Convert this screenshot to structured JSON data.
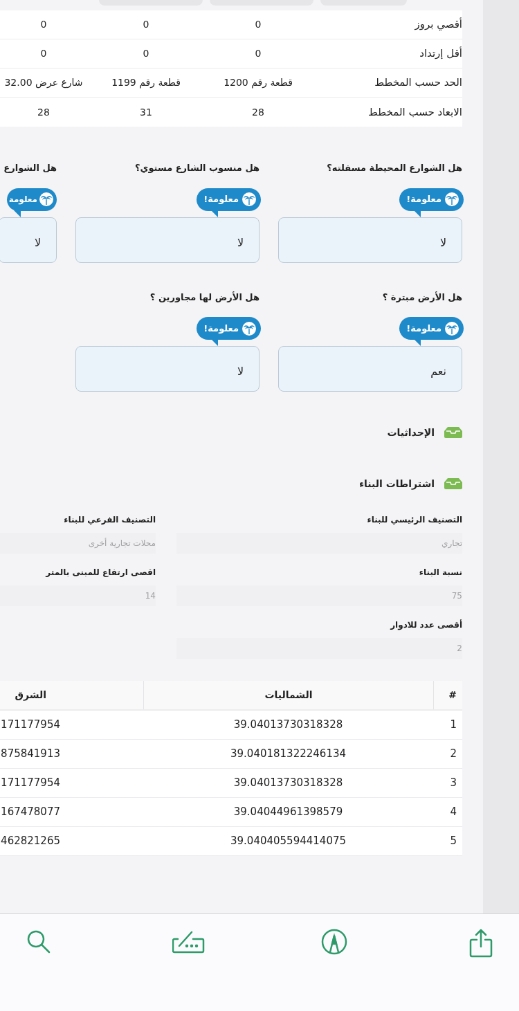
{
  "limits_table": {
    "rows": [
      {
        "label": "أقصي بروز",
        "values": [
          "0",
          "0",
          "0"
        ]
      },
      {
        "label": "أقل إرتداد",
        "values": [
          "0",
          "0",
          "0"
        ]
      },
      {
        "label": "الحد حسب المخطط",
        "values": [
          "قطعة رقم 1200",
          "قطعة رقم 1199",
          "شارع عرض 32.00"
        ]
      },
      {
        "label": "الابعاد حسب المخطط",
        "values": [
          "28",
          "31",
          "28"
        ]
      }
    ]
  },
  "question_rows": [
    [
      {
        "label": "هل الشوارع المحيطة مسفلته؟",
        "badge": "معلومة!",
        "answer": "لا"
      },
      {
        "label": "هل منسوب الشارع مستوي؟",
        "badge": "معلومة!",
        "answer": "لا"
      },
      {
        "label": "هل الشوارع",
        "badge": "معلومة",
        "answer": "لا"
      }
    ],
    [
      {
        "label": "هل الأرض مبترة ؟",
        "badge": "معلومة!",
        "answer": "نعم"
      },
      {
        "label": "هل الأرض لها مجاورين ؟",
        "badge": "معلومة!",
        "answer": "لا"
      }
    ]
  ],
  "sections": [
    {
      "title": "الإحداثيات"
    },
    {
      "title": "اشتراطات البناء"
    }
  ],
  "building_fields": [
    {
      "label": "التصنيف الرئيسي للبناء",
      "value": "تجاري"
    },
    {
      "label": "التصنيف الفرعي للبناء",
      "value": "محلات تجارية أخرى"
    },
    {
      "label": "نسبة البناء",
      "value": "75"
    },
    {
      "label": "اقصى ارتفاع للمبنى بالمتر",
      "value": "14"
    },
    {
      "label": "أقصى عدد للادوار",
      "value": "2"
    }
  ],
  "coordinates_table": {
    "columns": [
      "#",
      "الشماليات",
      "الشرق"
    ],
    "rows": [
      [
        "1",
        "39.04013730318328",
        "171177954"
      ],
      [
        "2",
        "39.040181322246134",
        "875841913"
      ],
      [
        "3",
        "39.04013730318328",
        "171177954"
      ],
      [
        "4",
        "39.04044961398579",
        "167478077"
      ],
      [
        "5",
        "39.040405594414075",
        "462821265"
      ]
    ]
  }
}
